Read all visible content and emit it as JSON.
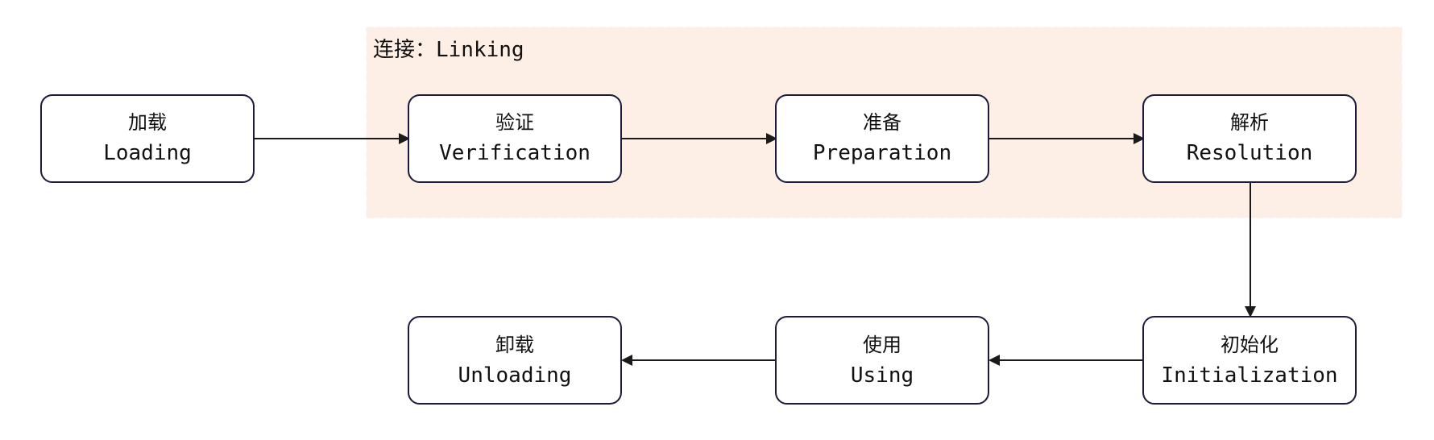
{
  "group": {
    "label": "连接：Linking",
    "fill": "#fdeee6"
  },
  "nodes": {
    "loading": {
      "cn": "加载",
      "en": "Loading"
    },
    "verification": {
      "cn": "验证",
      "en": "Verification"
    },
    "preparation": {
      "cn": "准备",
      "en": "Preparation"
    },
    "resolution": {
      "cn": "解析",
      "en": "Resolution"
    },
    "initialization": {
      "cn": "初始化",
      "en": "Initialization"
    },
    "using": {
      "cn": "使用",
      "en": "Using"
    },
    "unloading": {
      "cn": "卸载",
      "en": "Unloading"
    }
  },
  "edges": [
    {
      "from": "loading",
      "to": "verification"
    },
    {
      "from": "verification",
      "to": "preparation"
    },
    {
      "from": "preparation",
      "to": "resolution"
    },
    {
      "from": "resolution",
      "to": "initialization"
    },
    {
      "from": "initialization",
      "to": "using"
    },
    {
      "from": "using",
      "to": "unloading"
    }
  ],
  "colors": {
    "node_border": "#1c1b3d",
    "edge": "#1a1a1a"
  }
}
